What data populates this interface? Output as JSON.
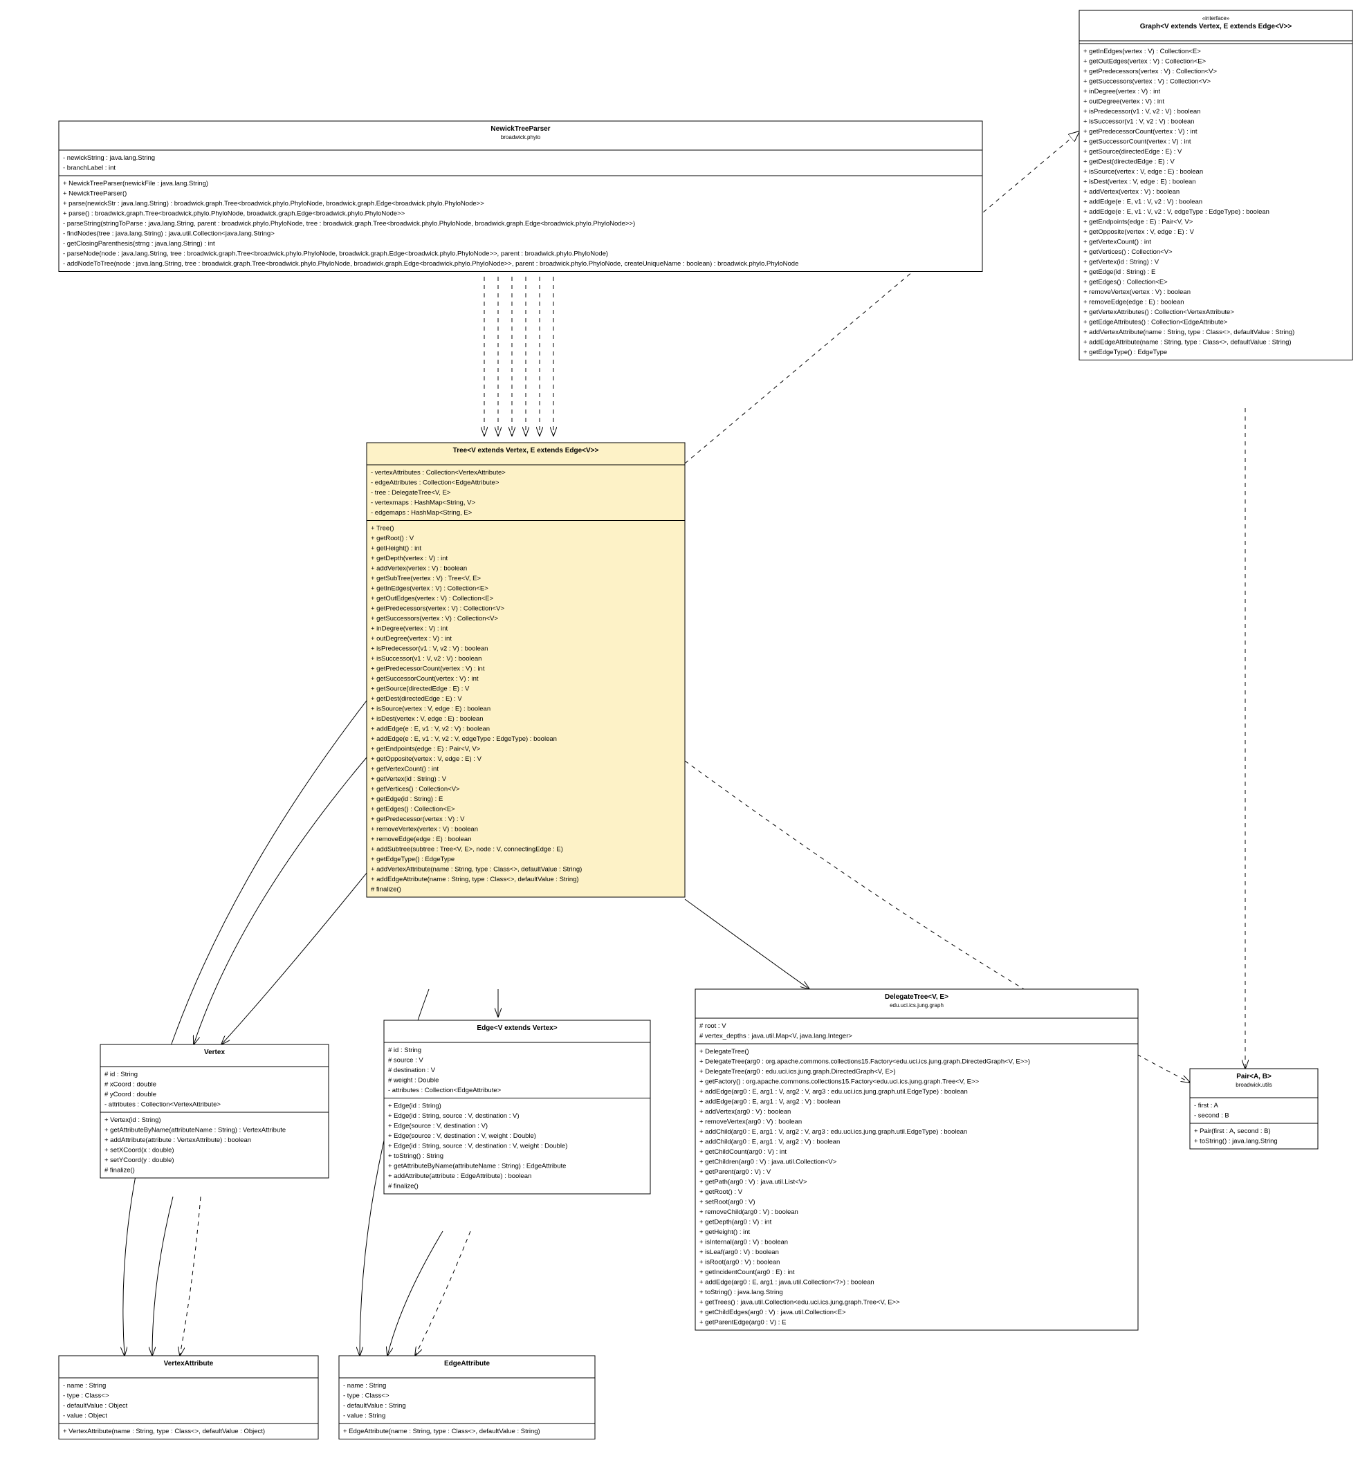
{
  "classes": {
    "NewickTreeParser": {
      "title": "NewickTreeParser",
      "subtitle": "broadwick.phylo",
      "fields": [
        "- newickString : java.lang.String",
        "- branchLabel : int"
      ],
      "methods": [
        "+ NewickTreeParser(newickFile : java.lang.String)",
        "+ NewickTreeParser()",
        "+ parse(newickStr : java.lang.String) : broadwick.graph.Tree<broadwick.phylo.PhyloNode, broadwick.graph.Edge<broadwick.phylo.PhyloNode>>",
        "+ parse() : broadwick.graph.Tree<broadwick.phylo.PhyloNode, broadwick.graph.Edge<broadwick.phylo.PhyloNode>>",
        "- parseString(stringToParse : java.lang.String, parent : broadwick.phylo.PhyloNode, tree : broadwick.graph.Tree<broadwick.phylo.PhyloNode, broadwick.graph.Edge<broadwick.phylo.PhyloNode>>)",
        "- findNodes(tree : java.lang.String) : java.util.Collection<java.lang.String>",
        "- getClosingParenthesis(strng : java.lang.String) : int",
        "- parseNode(node : java.lang.String, tree : broadwick.graph.Tree<broadwick.phylo.PhyloNode, broadwick.graph.Edge<broadwick.phylo.PhyloNode>>, parent : broadwick.phylo.PhyloNode)",
        "- addNodeToTree(node : java.lang.String, tree : broadwick.graph.Tree<broadwick.phylo.PhyloNode, broadwick.graph.Edge<broadwick.phylo.PhyloNode>>, parent : broadwick.phylo.PhyloNode, createUniqueName : boolean) : broadwick.phylo.PhyloNode"
      ]
    },
    "Graph": {
      "stereotype": "«interface»",
      "title": "Graph<V extends Vertex, E extends Edge<V>>",
      "subtitle": "",
      "fields": [],
      "methods": [
        "+ getInEdges(vertex : V) : Collection<E>",
        "+ getOutEdges(vertex : V) : Collection<E>",
        "+ getPredecessors(vertex : V) : Collection<V>",
        "+ getSuccessors(vertex : V) : Collection<V>",
        "+ inDegree(vertex : V) : int",
        "+ outDegree(vertex : V) : int",
        "+ isPredecessor(v1 : V, v2 : V) : boolean",
        "+ isSuccessor(v1 : V, v2 : V) : boolean",
        "+ getPredecessorCount(vertex : V) : int",
        "+ getSuccessorCount(vertex : V) : int",
        "+ getSource(directedEdge : E) : V",
        "+ getDest(directedEdge : E) : V",
        "+ isSource(vertex : V, edge : E) : boolean",
        "+ isDest(vertex : V, edge : E) : boolean",
        "+ addVertex(vertex : V) : boolean",
        "+ addEdge(e : E, v1 : V, v2 : V) : boolean",
        "+ addEdge(e : E, v1 : V, v2 : V, edgeType : EdgeType) : boolean",
        "+ getEndpoints(edge : E) : Pair<V, V>",
        "+ getOpposite(vertex : V, edge : E) : V",
        "+ getVertexCount() : int",
        "+ getVertices() : Collection<V>",
        "+ getVertex(id : String) : V",
        "+ getEdge(id : String) : E",
        "+ getEdges() : Collection<E>",
        "+ removeVertex(vertex : V) : boolean",
        "+ removeEdge(edge : E) : boolean",
        "+ getVertexAttributes() : Collection<VertexAttribute>",
        "+ getEdgeAttributes() : Collection<EdgeAttribute>",
        "+ addVertexAttribute(name : String, type : Class<>, defaultValue : String)",
        "+ addEdgeAttribute(name : String, type : Class<>, defaultValue : String)",
        "+ getEdgeType() : EdgeType"
      ]
    },
    "Tree": {
      "title": "Tree<V extends Vertex, E extends Edge<V>>",
      "subtitle": "",
      "fields": [
        "- vertexAttributes : Collection<VertexAttribute>",
        "- edgeAttributes : Collection<EdgeAttribute>",
        "- tree : DelegateTree<V, E>",
        "- vertexmaps : HashMap<String, V>",
        "- edgemaps : HashMap<String, E>"
      ],
      "methods": [
        "+ Tree()",
        "+ getRoot() : V",
        "+ getHeight() : int",
        "+ getDepth(vertex : V) : int",
        "+ addVertex(vertex : V) : boolean",
        "+ getSubTree(vertex : V) : Tree<V, E>",
        "+ getInEdges(vertex : V) : Collection<E>",
        "+ getOutEdges(vertex : V) : Collection<E>",
        "+ getPredecessors(vertex : V) : Collection<V>",
        "+ getSuccessors(vertex : V) : Collection<V>",
        "+ inDegree(vertex : V) : int",
        "+ outDegree(vertex : V) : int",
        "+ isPredecessor(v1 : V, v2 : V) : boolean",
        "+ isSuccessor(v1 : V, v2 : V) : boolean",
        "+ getPredecessorCount(vertex : V) : int",
        "+ getSuccessorCount(vertex : V) : int",
        "+ getSource(directedEdge : E) : V",
        "+ getDest(directedEdge : E) : V",
        "+ isSource(vertex : V, edge : E) : boolean",
        "+ isDest(vertex : V, edge : E) : boolean",
        "+ addEdge(e : E, v1 : V, v2 : V) : boolean",
        "+ addEdge(e : E, v1 : V, v2 : V, edgeType : EdgeType) : boolean",
        "+ getEndpoints(edge : E) : Pair<V, V>",
        "+ getOpposite(vertex : V, edge : E) : V",
        "+ getVertexCount() : int",
        "+ getVertex(id : String) : V",
        "+ getVertices() : Collection<V>",
        "+ getEdge(id : String) : E",
        "+ getEdges() : Collection<E>",
        "+ getPredecessor(vertex : V) : V",
        "+ removeVertex(vertex : V) : boolean",
        "+ removeEdge(edge : E) : boolean",
        "+ addSubtree(subtree : Tree<V, E>, node : V, connectingEdge : E)",
        "+ getEdgeType() : EdgeType",
        "+ addVertexAttribute(name : String, type : Class<>, defaultValue : String)",
        "+ addEdgeAttribute(name : String, type : Class<>, defaultValue : String)",
        "# finalize()"
      ]
    },
    "Vertex": {
      "title": "Vertex",
      "subtitle": "",
      "fields": [
        "# id : String",
        "# xCoord : double",
        "# yCoord : double",
        "- attributes : Collection<VertexAttribute>"
      ],
      "methods": [
        "+ Vertex(id : String)",
        "+ getAttributeByName(attributeName : String) : VertexAttribute",
        "+ addAttribute(attribute : VertexAttribute) : boolean",
        "+ setXCoord(x : double)",
        "+ setYCoord(y : double)",
        "# finalize()"
      ]
    },
    "Edge": {
      "title": "Edge<V extends Vertex>",
      "subtitle": "",
      "fields": [
        "# id : String",
        "# source : V",
        "# destination : V",
        "# weight : Double",
        "- attributes : Collection<EdgeAttribute>"
      ],
      "methods": [
        "+ Edge(id : String)",
        "+ Edge(id : String, source : V, destination : V)",
        "+ Edge(source : V, destination : V)",
        "+ Edge(source : V, destination : V, weight : Double)",
        "+ Edge(id : String, source : V, destination : V, weight : Double)",
        "+ toString() : String",
        "+ getAttributeByName(attributeName : String) : EdgeAttribute",
        "+ addAttribute(attribute : EdgeAttribute) : boolean",
        "# finalize()"
      ]
    },
    "DelegateTree": {
      "title": "DelegateTree<V, E>",
      "subtitle": "edu.uci.ics.jung.graph",
      "fields": [
        "# root : V",
        "# vertex_depths : java.util.Map<V, java.lang.Integer>"
      ],
      "methods": [
        "+ DelegateTree()",
        "+ DelegateTree(arg0 : org.apache.commons.collections15.Factory<edu.uci.ics.jung.graph.DirectedGraph<V, E>>)",
        "+ DelegateTree(arg0 : edu.uci.ics.jung.graph.DirectedGraph<V, E>)",
        "+ getFactory() : org.apache.commons.collections15.Factory<edu.uci.ics.jung.graph.Tree<V, E>>",
        "+ addEdge(arg0 : E, arg1 : V, arg2 : V, arg3 : edu.uci.ics.jung.graph.util.EdgeType) : boolean",
        "+ addEdge(arg0 : E, arg1 : V, arg2 : V) : boolean",
        "+ addVertex(arg0 : V) : boolean",
        "+ removeVertex(arg0 : V) : boolean",
        "+ addChild(arg0 : E, arg1 : V, arg2 : V, arg3 : edu.uci.ics.jung.graph.util.EdgeType) : boolean",
        "+ addChild(arg0 : E, arg1 : V, arg2 : V) : boolean",
        "+ getChildCount(arg0 : V) : int",
        "+ getChildren(arg0 : V) : java.util.Collection<V>",
        "+ getParent(arg0 : V) : V",
        "+ getPath(arg0 : V) : java.util.List<V>",
        "+ getRoot() : V",
        "+ setRoot(arg0 : V)",
        "+ removeChild(arg0 : V) : boolean",
        "+ getDepth(arg0 : V) : int",
        "+ getHeight() : int",
        "+ isInternal(arg0 : V) : boolean",
        "+ isLeaf(arg0 : V) : boolean",
        "+ isRoot(arg0 : V) : boolean",
        "+ getIncidentCount(arg0 : E) : int",
        "+ addEdge(arg0 : E, arg1 : java.util.Collection<?>) : boolean",
        "+ toString() : java.lang.String",
        "+ getTrees() : java.util.Collection<edu.uci.ics.jung.graph.Tree<V, E>>",
        "+ getChildEdges(arg0 : V) : java.util.Collection<E>",
        "+ getParentEdge(arg0 : V) : E"
      ]
    },
    "Pair": {
      "title": "Pair<A, B>",
      "subtitle": "broadwick.utils",
      "fields": [
        "- first : A",
        "- second : B"
      ],
      "methods": [
        "+ Pair(first : A, second : B)",
        "+ toString() : java.lang.String"
      ]
    },
    "VertexAttribute": {
      "title": "VertexAttribute",
      "subtitle": "",
      "fields": [
        "- name : String",
        "- type : Class<>",
        "- defaultValue : Object",
        "- value : Object"
      ],
      "methods": [
        "+ VertexAttribute(name : String, type : Class<>, defaultValue : Object)"
      ]
    },
    "EdgeAttribute": {
      "title": "EdgeAttribute",
      "subtitle": "",
      "fields": [
        "- name : String",
        "- type : Class<>",
        "- defaultValue : String",
        "- value : String"
      ],
      "methods": [
        "+ EdgeAttribute(name : String, type : Class<>, defaultValue : String)"
      ]
    }
  }
}
